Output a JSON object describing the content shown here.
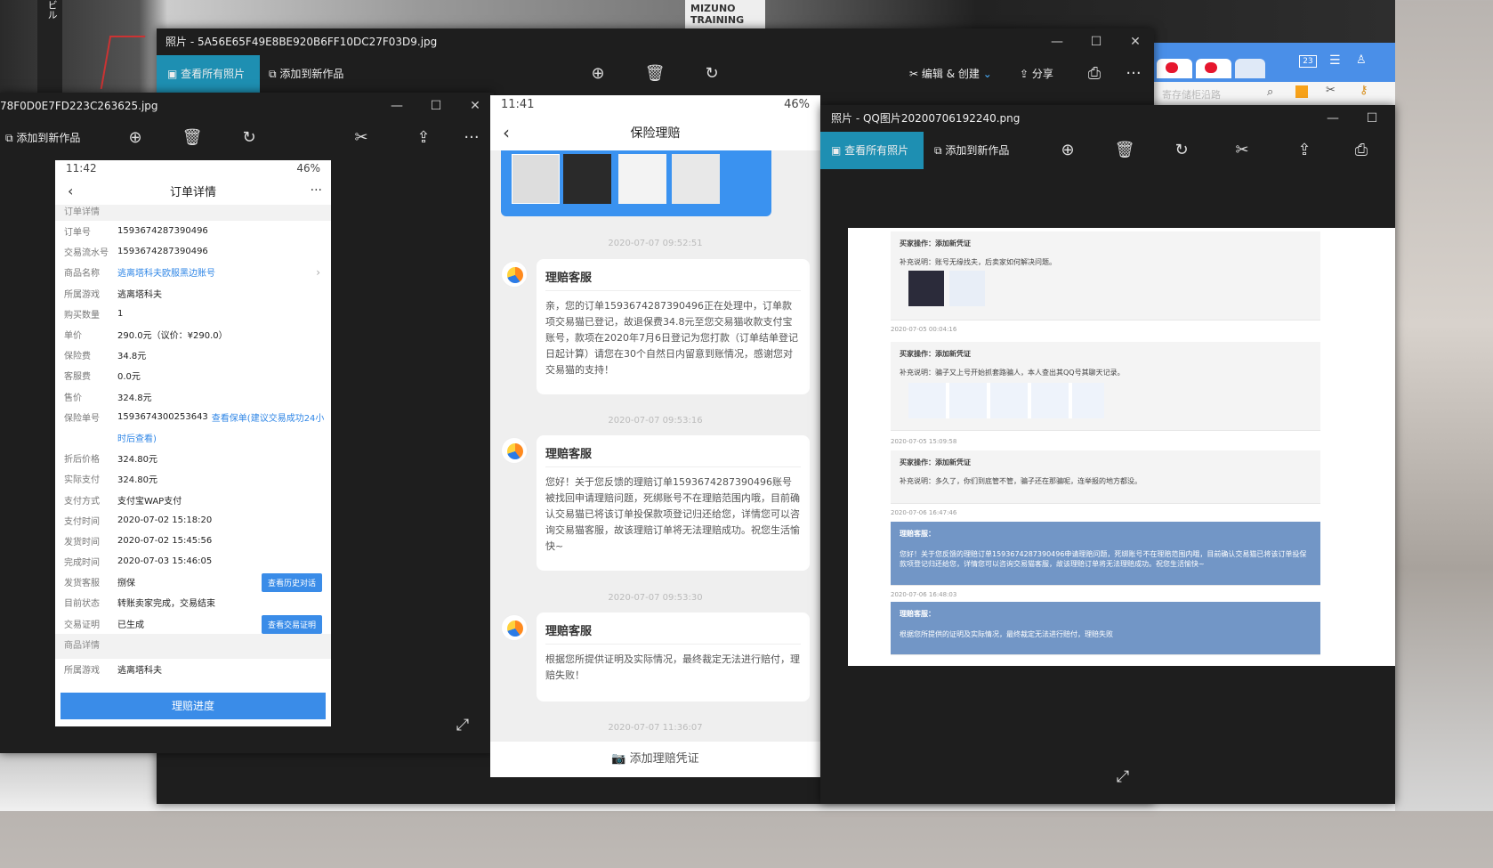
{
  "wallpaper": {
    "billboard_text": "MIZUNO\nTRAINING",
    "left_text": "ビル"
  },
  "browser": {
    "badge": "23",
    "search_placeholder": "寄存储柜沿路"
  },
  "window_back": {
    "title": "照片 - 5A56E65F49E8BE920B6FF10DC27F03D9.jpg",
    "view_all": "查看所有照片",
    "add_to": "添加到新作品",
    "edit_create": "编辑 & 创建",
    "share": "分享",
    "more": "···"
  },
  "window_left": {
    "title": "78F0D0E7FD223C263625.jpg",
    "add_to": "添加到新作品",
    "more": "···"
  },
  "window_right": {
    "title": "照片 - QQ图片20200706192240.png",
    "view_all": "查看所有照片",
    "add_to": "添加到新作品"
  },
  "order_phone": {
    "time": "11:42",
    "battery": "46%",
    "title": "订单详情",
    "section1": "订单详情",
    "rows": [
      {
        "k": "订单号",
        "v": "1593674287390496"
      },
      {
        "k": "交易流水号",
        "v": "1593674287390496"
      },
      {
        "k": "商品名称",
        "v": "逃离塔科夫欧服黑边账号",
        "link": true
      },
      {
        "k": "所属游戏",
        "v": "逃离塔科夫"
      },
      {
        "k": "购买数量",
        "v": "1"
      },
      {
        "k": "单价",
        "v": "290.0元（议价：¥290.0）"
      },
      {
        "k": "保险费",
        "v": "34.8元"
      },
      {
        "k": "客服费",
        "v": "0.0元"
      },
      {
        "k": "售价",
        "v": "324.8元"
      },
      {
        "k": "保险单号",
        "v": "1593674300253643",
        "extra": "查看保单(建议交易成功24小"
      },
      {
        "k": "",
        "v": "时后查看)",
        "link": true
      },
      {
        "k": "折后价格",
        "v": "324.80元"
      },
      {
        "k": "实际支付",
        "v": "324.80元"
      },
      {
        "k": "支付方式",
        "v": "支付宝WAP支付"
      },
      {
        "k": "支付时间",
        "v": "2020-07-02 15:18:20"
      },
      {
        "k": "发货时间",
        "v": "2020-07-02 15:45:56"
      },
      {
        "k": "完成时间",
        "v": "2020-07-03 15:46:05"
      },
      {
        "k": "发货客服",
        "v": "捌保",
        "btn": "查看历史对话"
      },
      {
        "k": "目前状态",
        "v": "转账卖家完成，交易结束"
      },
      {
        "k": "交易证明",
        "v": "已生成",
        "btn": "查看交易证明"
      }
    ],
    "section2": "商品详情",
    "row_game": {
      "k": "所属游戏",
      "v": "逃离塔科夫"
    },
    "main_button": "理赔进度"
  },
  "claim_phone": {
    "time": "11:41",
    "battery": "46%",
    "title": "保险理赔",
    "messages": [
      {
        "time": "2020-07-07 09:52:51",
        "who": "理赔客服",
        "text": "亲，您的订单1593674287390496正在处理中，订单款项交易猫已登记，故退保费34.8元至您交易猫收款支付宝账号，款项在2020年7月6日登记为您打款（订单结单登记日起计算）请您在30个自然日内留意到账情况，感谢您对交易猫的支持！"
      },
      {
        "time": "2020-07-07 09:53:16",
        "who": "理赔客服",
        "text": "您好！关于您反馈的理赔订单1593674287390496账号被找回申请理赔问题，死绑账号不在理赔范围内哦，目前确认交易猫已将该订单投保款项登记归还给您，详情您可以咨询交易猫客服，故该理赔订单将无法理赔成功。祝您生活愉快~"
      },
      {
        "time": "2020-07-07 09:53:30",
        "who": "理赔客服",
        "text": "根据您所提供证明及实际情况，最终裁定无法进行赔付，理赔失败！"
      }
    ],
    "last_time": "2020-07-07 11:36:07",
    "bottom": "添加理赔凭证"
  },
  "qq_image": {
    "items": [
      {
        "head": "买家操作：添加新凭证",
        "body": "补充说明：账号无缘找夫，后卖家如何解决问题。",
        "blue": false
      },
      {
        "time": "2020-07-05 00:04:16"
      },
      {
        "head": "买家操作：添加新凭证",
        "body": "补充说明：骗子又上号开始抓套路骗人，本人查出其QQ号其聊天记录。",
        "blue": false
      },
      {
        "time": "2020-07-05 15:09:58"
      },
      {
        "head": "买家操作：添加新凭证",
        "body": "补充说明：多久了，你们到底管不管，骗子还在那骗呢，连举报的地方都没。",
        "blue": false
      },
      {
        "time": "2020-07-06 16:47:46"
      },
      {
        "head": "理赔客服：",
        "body": "您好！关于您反馈的理赔订单1593674287390496申请理赔问题，死绑账号不在理赔范围内哦，目前确认交易猫已将该订单投保款项登记归还给您，详情您可以咨询交易猫客服，故该理赔订单将无法理赔成功。祝您生活愉快~",
        "blue": true
      },
      {
        "time": "2020-07-06 16:48:03"
      },
      {
        "head": "理赔客服：",
        "body": "根据您所提供的证明及实际情况，最终裁定无法进行赔付，理赔失败",
        "blue": true
      }
    ]
  }
}
